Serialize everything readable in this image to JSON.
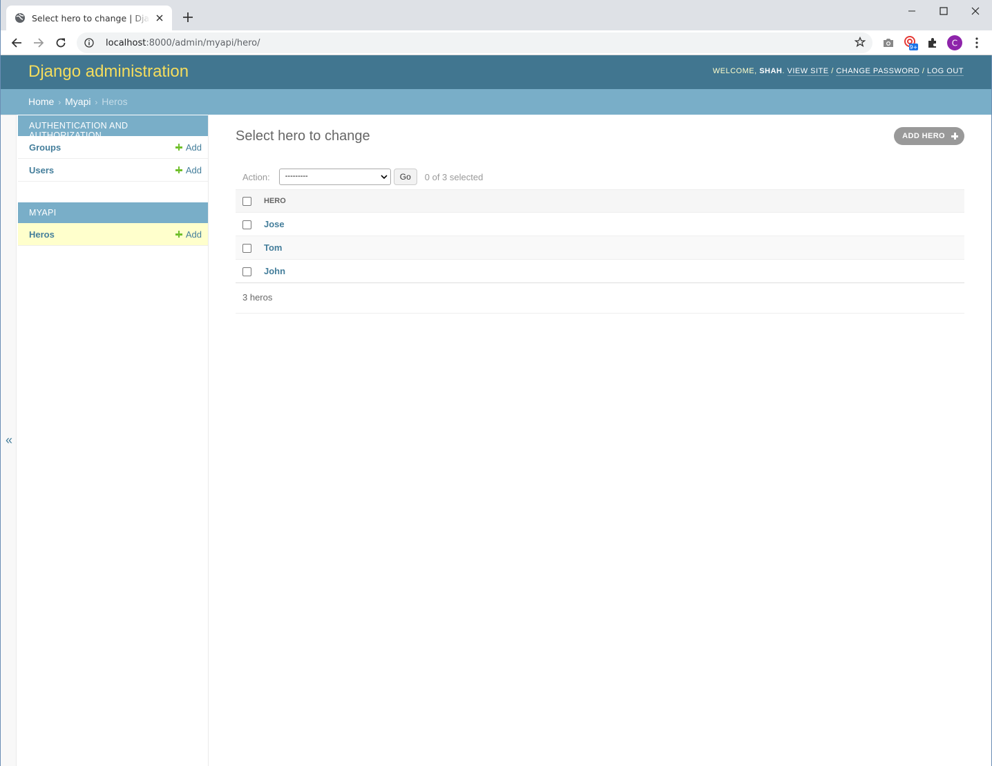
{
  "browser": {
    "tab_title": "Select hero to change | Django site admin",
    "url_host": "localhost",
    "url_rest": ":8000/admin/myapi/hero/",
    "profile_initial": "C",
    "extension_badge": "9+"
  },
  "header": {
    "branding": "Django administration",
    "welcome": "Welcome,",
    "username": "shah",
    "view_site": "View site",
    "change_password": "Change password",
    "log_out": "Log out",
    "sep": "/"
  },
  "breadcrumbs": {
    "home": "Home",
    "app": "Myapi",
    "current": "Heros",
    "sep": "›"
  },
  "sidebar": {
    "toggle": "«",
    "modules": [
      {
        "caption": "Authentication and Authorization",
        "items": [
          {
            "name": "Groups",
            "add": "Add"
          },
          {
            "name": "Users",
            "add": "Add"
          }
        ]
      },
      {
        "caption": "Myapi",
        "items": [
          {
            "name": "Heros",
            "add": "Add"
          }
        ]
      }
    ]
  },
  "content": {
    "title": "Select hero to change",
    "add_button": "Add hero",
    "action_label": "Action:",
    "action_selected": "---------",
    "go_button": "Go",
    "counter": "0 of 3 selected",
    "column_header": "Hero",
    "rows": [
      "Jose",
      "Tom",
      "John"
    ],
    "paginator": "3 heros"
  },
  "colors": {
    "header_bg": "#417690",
    "branding": "#f5dd5d",
    "breadcrumb_bg": "#79aec8",
    "link": "#447e9b",
    "add_green": "#70bf2b",
    "current_row": "#ffffcc",
    "profile_avatar": "#8e24aa"
  }
}
